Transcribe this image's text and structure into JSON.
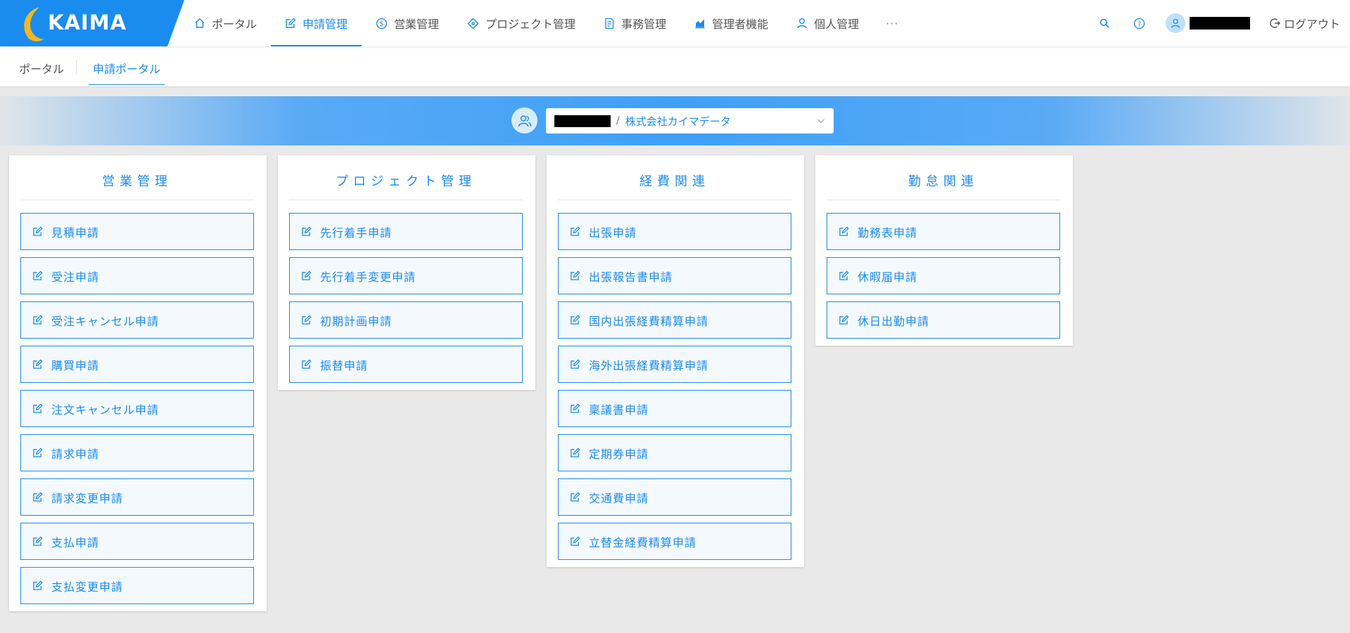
{
  "app": {
    "logo_text": "KAIMA"
  },
  "nav": {
    "items": [
      {
        "label": "ポータル",
        "icon": "home-icon"
      },
      {
        "label": "申請管理",
        "icon": "edit-icon"
      },
      {
        "label": "営業管理",
        "icon": "dollar-icon"
      },
      {
        "label": "プロジェクト管理",
        "icon": "diamond-icon"
      },
      {
        "label": "事務管理",
        "icon": "document-icon"
      },
      {
        "label": "管理者機能",
        "icon": "chart-icon"
      },
      {
        "label": "個人管理",
        "icon": "user-icon"
      }
    ],
    "more": "···",
    "active_index": 1
  },
  "header": {
    "logout_label": "ログアウト"
  },
  "subtabs": [
    {
      "label": "ポータル"
    },
    {
      "label": "申請ポータル"
    }
  ],
  "org": {
    "separator": "/",
    "name": "株式会社カイマデータ"
  },
  "categories": [
    {
      "title": "営業管理",
      "items": [
        "見積申請",
        "受注申請",
        "受注キャンセル申請",
        "購買申請",
        "注文キャンセル申請",
        "請求申請",
        "請求変更申請",
        "支払申請",
        "支払変更申請"
      ]
    },
    {
      "title": "プロジェクト管理",
      "items": [
        "先行着手申請",
        "先行着手変更申請",
        "初期計画申請",
        "振替申請"
      ]
    },
    {
      "title": "経費関連",
      "items": [
        "出張申請",
        "出張報告書申請",
        "国内出張経費精算申請",
        "海外出張経費精算申請",
        "稟議書申請",
        "定期券申請",
        "交通費申請",
        "立替金経費精算申請"
      ]
    },
    {
      "title": "勤怠関連",
      "items": [
        "勤務表申請",
        "休暇届申請",
        "休日出勤申請"
      ]
    }
  ],
  "colors": {
    "accent": "#1a8cf0",
    "background": "#e9e9e9",
    "button_fill": "#f4f9ff"
  }
}
